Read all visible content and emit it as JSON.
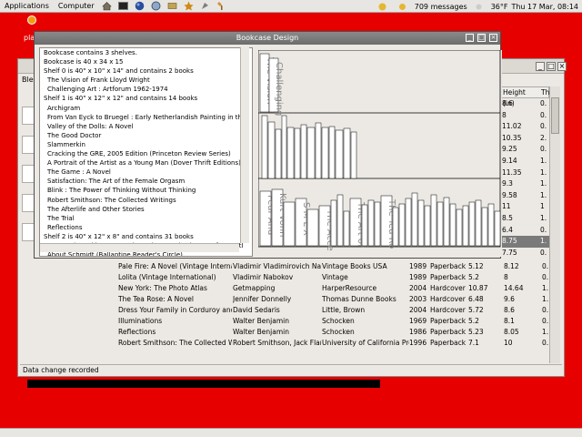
{
  "top_panel": {
    "applications_label": "Applications",
    "computer_label": "Computer",
    "messages": "709 messages",
    "weather": "36°F",
    "datetime": "Thu 17 Mar, 08:14"
  },
  "desktop": {
    "label": "pla"
  },
  "main_window": {
    "tab_label": "Ble",
    "status": "Data change recorded",
    "table_headers": [
      "Height (in)",
      "Th"
    ],
    "right_values": [
      [
        "8.6",
        "0."
      ],
      [
        "8",
        "0."
      ],
      [
        "11.02",
        "0."
      ],
      [
        "10.35",
        "2."
      ],
      [
        "9.25",
        "0."
      ],
      [
        "9.14",
        "1."
      ],
      [
        "11.35",
        "1."
      ],
      [
        "9.3",
        "1."
      ],
      [
        "9.58",
        "1."
      ],
      [
        "11",
        "1"
      ],
      [
        "8.5",
        "1."
      ],
      [
        "6.4",
        "0."
      ],
      [
        "8.75",
        "1."
      ],
      [
        "7.75",
        "0."
      ]
    ],
    "rows": [
      [
        "Pale Fire: A Novel (Vintage Internatic",
        "Vladimir Vladimirovich Nab",
        "Vintage Books USA",
        "1989",
        "Paperback",
        "5.12",
        "8.12",
        "0."
      ],
      [
        "Lolita (Vintage International)",
        "Vladimir Nabokov",
        "Vintage",
        "1989",
        "Paperback",
        "5.2",
        "8",
        "0."
      ],
      [
        "New York: The Photo Atlas",
        "Getmapping",
        "HarperResource",
        "2004",
        "Hardcover",
        "10.87",
        "14.64",
        "1."
      ],
      [
        "The Tea Rose: A Novel",
        "Jennifer Donnelly",
        "Thomas Dunne Books",
        "2003",
        "Hardcover",
        "6.48",
        "9.6",
        "1."
      ],
      [
        "Dress Your Family in Corduroy and D",
        "David Sedaris",
        "Little, Brown",
        "2004",
        "Hardcover",
        "5.72",
        "8.6",
        "0."
      ],
      [
        "Illuminations",
        "Walter Benjamin",
        "Schocken",
        "1969",
        "Paperback",
        "5.2",
        "8.1",
        "0."
      ],
      [
        "Reflections",
        "Walter Benjamin",
        "Schocken",
        "1986",
        "Paperback",
        "5.23",
        "8.05",
        "1."
      ],
      [
        "Robert Smithson: The Collected Wri",
        "Robert Smithson, Jack Flan",
        "University of California Pre",
        "1996",
        "Paperback",
        "7.1",
        "10",
        "0."
      ]
    ]
  },
  "dialog": {
    "title": "Bookcase Design",
    "text_lines": [
      {
        "t": "Bookcase contains 3 shelves.",
        "i": false
      },
      {
        "t": "Bookcase is 40 x 34 x 15",
        "i": false
      },
      {
        "t": "Shelf 0 is 40\" x 10\" x 14\" and contains 2 books",
        "i": false
      },
      {
        "t": "The Vision of Frank Lloyd Wright",
        "i": true
      },
      {
        "t": "Challenging Art : Artforum 1962-1974",
        "i": true
      },
      {
        "t": "Shelf 1 is 40\" x 12\" x 12\" and contains 14 books",
        "i": false
      },
      {
        "t": "Archigram",
        "i": true
      },
      {
        "t": "From Van Eyck to Bruegel : Early Netherlandish Painting in the",
        "i": true
      },
      {
        "t": "Valley of the Dolls: A Novel",
        "i": true
      },
      {
        "t": "The Good Doctor",
        "i": true
      },
      {
        "t": "Slammerkin",
        "i": true
      },
      {
        "t": "Cracking the GRE, 2005 Edition (Princeton Review Series)",
        "i": true
      },
      {
        "t": "A Portrait of the Artist as a Young Man (Dover Thrift Editions)",
        "i": true
      },
      {
        "t": "The Game : A Novel",
        "i": true
      },
      {
        "t": "Satisfaction: The Art of the Female Orgasm",
        "i": true
      },
      {
        "t": "Blink : The Power of Thinking Without Thinking",
        "i": true
      },
      {
        "t": "Robert Smithson: The Collected Writings",
        "i": true
      },
      {
        "t": "The Afterlife and Other Stories",
        "i": true
      },
      {
        "t": "The Trial",
        "i": true
      },
      {
        "t": "Reflections",
        "i": true
      },
      {
        "t": "Shelf 2 is 40\" x 12\" x 8\" and contains 31 books",
        "i": false
      },
      {
        "t": "Fear And Loathing In America : The Brutal Odyssey of an Outl",
        "i": true
      },
      {
        "t": "About Schmidt (Ballantine Reader's Circle)",
        "i": true
      }
    ],
    "spine_texts": {
      "shelf0": [
        "Challenging",
        "The Vision"
      ],
      "shelf2": [
        "Kurt Vonn",
        "Fear And",
        "S M L X",
        "The Acce",
        "The Art of",
        "The Tea Ro"
      ]
    }
  },
  "colors": {
    "desktop": "#e60000",
    "panel": "#e8e6e2",
    "selection": "#7a7a7a"
  }
}
